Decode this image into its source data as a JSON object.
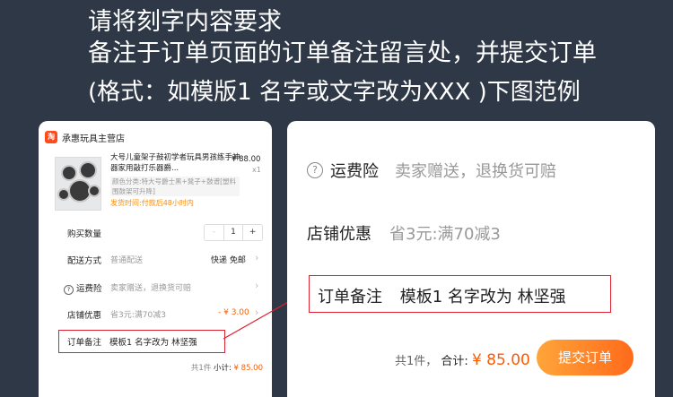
{
  "instructions": {
    "line1": "请将刻字内容要求",
    "line2": "备注于订单页面的订单备注留言处，并提交订单",
    "line3": "(格式：如模版1 名字或文字改为XXX )下图范例"
  },
  "left_card": {
    "shop_icon": "淘",
    "shop_name": "承惠玩具主营店",
    "product_name": "大号儿童架子鼓初学者玩具男孩练手神器家用敲打乐器爵...",
    "price": "¥ 88.00",
    "quantity": "x1",
    "sku": "颜色分类:特大号爵士黑+凳子+鼓谱[塑料围鼓架可升降]",
    "ship_time": "发货时间:付款后48小时内",
    "buy_qty_label": "购买数量",
    "stepper_minus": "-",
    "stepper_value": "1",
    "stepper_plus": "+",
    "delivery_label": "配送方式",
    "delivery_type": "普通配送",
    "delivery_value": "快递 免邮",
    "insurance_label": "运费险",
    "insurance_value": "卖家赠送，退换货可赔",
    "discount_label": "店铺优惠",
    "discount_value": "省3元:满70减3",
    "discount_amount": "- ¥ 3.00",
    "note_label": "订单备注",
    "note_value": "模板1 名字改为 林坚强",
    "footer_count": "共1件",
    "footer_subtotal_label": "小计:",
    "footer_subtotal": "¥ 85.00"
  },
  "right_card": {
    "insurance_label": "运费险",
    "insurance_value": "卖家赠送，退换货可赔",
    "discount_label": "店铺优惠",
    "discount_value": "省3元:满70减3",
    "note_label": "订单备注",
    "note_value": "模板1 名字改为 林坚强",
    "footer_count": "共1件，",
    "footer_total_label": "合计:",
    "footer_total": "¥ 85.00",
    "submit_label": "提交订单"
  },
  "colors": {
    "background": "#2f3847",
    "accent": "#ff5a00",
    "highlight_border": "#dd2233"
  }
}
